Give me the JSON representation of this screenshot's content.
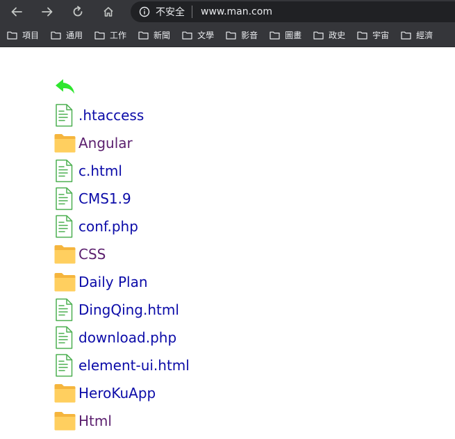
{
  "browser": {
    "security_label": "不安全",
    "url": "www.man.com",
    "bookmarks": [
      {
        "label": "項目"
      },
      {
        "label": "通用"
      },
      {
        "label": "工作"
      },
      {
        "label": "新聞"
      },
      {
        "label": "文學"
      },
      {
        "label": "影音"
      },
      {
        "label": "圖畫"
      },
      {
        "label": "政史"
      },
      {
        "label": "宇宙"
      },
      {
        "label": "經濟"
      }
    ]
  },
  "listing": {
    "back_icon": "back-arrow-icon",
    "entries": [
      {
        "name": ".htaccess",
        "type": "file",
        "visited": false
      },
      {
        "name": "Angular",
        "type": "folder",
        "visited": true
      },
      {
        "name": "c.html",
        "type": "file",
        "visited": false
      },
      {
        "name": "CMS1.9",
        "type": "file",
        "visited": false
      },
      {
        "name": "conf.php",
        "type": "file",
        "visited": false
      },
      {
        "name": "CSS",
        "type": "folder",
        "visited": true
      },
      {
        "name": "Daily Plan",
        "type": "folder",
        "visited": false
      },
      {
        "name": "DingQing.html",
        "type": "file",
        "visited": false
      },
      {
        "name": "download.php",
        "type": "file",
        "visited": false
      },
      {
        "name": "element-ui.html",
        "type": "file",
        "visited": false
      },
      {
        "name": "HeroKuApp",
        "type": "folder",
        "visited": false
      },
      {
        "name": "Html",
        "type": "folder",
        "visited": true
      }
    ]
  },
  "colors": {
    "chrome_bg": "#35363a",
    "omnibox_bg": "#202124",
    "link": "#0b0ba8",
    "visited_link": "#5b1f6e",
    "folder": "#ffc54a",
    "file_icon": "#4caf50",
    "back_arrow": "#2ee62e"
  }
}
